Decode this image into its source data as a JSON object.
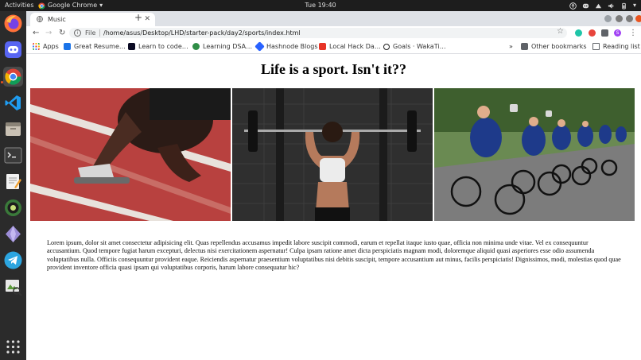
{
  "os": {
    "activities": "Activities",
    "app_name": "Google Chrome",
    "clock": "Tue 19:40"
  },
  "browser": {
    "tab_title": "Music",
    "url_scheme": "File",
    "url": "/home/asus/Desktop/LHD/starter-pack/day2/sports/index.html",
    "bookmarks": [
      {
        "label": "Apps",
        "icon": "apps-grid-icon",
        "color": "#e94235"
      },
      {
        "label": "Great Resume…",
        "icon": "resume-icon",
        "color": "#1a73e8"
      },
      {
        "label": "Learn to code…",
        "icon": "code-icon",
        "color": "#0a0a23"
      },
      {
        "label": "Learning DSA…",
        "icon": "dsa-icon",
        "color": "#2f8d46"
      },
      {
        "label": "Hashnode Blogs",
        "icon": "hashnode-icon",
        "color": "#2962ff"
      },
      {
        "label": "Local Hack Da…",
        "icon": "lhd-icon",
        "color": "#e73427"
      },
      {
        "label": "Goals · WakaTi…",
        "icon": "wakatime-icon",
        "color": "#222222"
      }
    ],
    "more_bookmarks": "»",
    "other_bookmarks": "Other bookmarks",
    "reading_list": "Reading list",
    "profile_initial": "S"
  },
  "page": {
    "heading": "Life is a sport. Isn't it??",
    "images": [
      {
        "name": "sprinter-photo",
        "desc_icon": "sprinter-image"
      },
      {
        "name": "weightlifter-photo",
        "desc_icon": "weightlifter-image"
      },
      {
        "name": "cyclists-photo",
        "desc_icon": "cyclists-image"
      }
    ],
    "paragraph": "Lorem ipsum, dolor sit amet consectetur adipisicing elit. Quas repellendus accusamus impedit labore suscipit commodi, earum et repellat itaque iusto quae, officia non minima unde vitae. Vel ex consequuntur accusantium. Quod tempore fugiat harum excepturi, delectus nisi exercitationem aspernatur! Culpa ipsam ratione amet dicta perspiciatis magnam modi, doloremque aliquid quasi asperiores esse odio assumenda voluptatibus nulla. Officiis consequuntur provident eaque. Reiciendis aspernatur praesentium voluptatibus nisi debitis suscipit, tempore accusantium aut minus, facilis perspiciatis! Dignissimos, modi, molestias quod quae provident inventore officia quasi ipsam qui voluptatibus corporis, harum labore consequatur hic?"
  },
  "colors": {
    "topbar": "#1d1d1d",
    "dock": "#2b2b2b",
    "tabstrip": "#dee1e6",
    "ubuntu_orange": "#e95420"
  }
}
